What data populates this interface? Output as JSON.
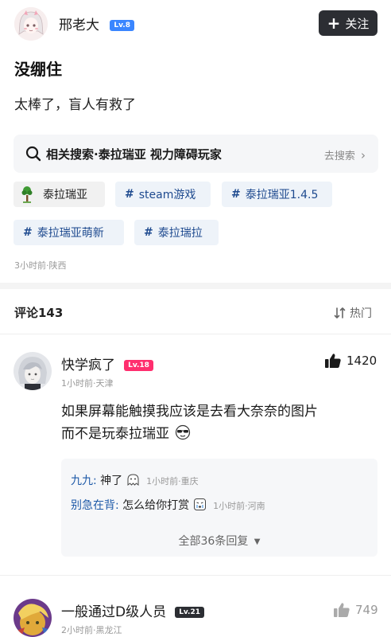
{
  "author": {
    "name": "邢老大",
    "level": "Lv.8",
    "follow_label": "关注"
  },
  "post": {
    "title": "没绷住",
    "body": "太棒了，盲人有救了",
    "related_search": {
      "label": "相关搜索·泰拉瑞亚 视力障碍玩家",
      "action": "去搜索"
    },
    "tags": [
      {
        "label": "泰拉瑞亚"
      },
      {
        "label": "steam游戏"
      },
      {
        "label": "泰拉瑞亚1.4.5"
      },
      {
        "label": "泰拉瑞亚萌新"
      },
      {
        "label": "泰拉瑞拉"
      }
    ],
    "meta": "3小时前·陕西"
  },
  "comments_header": {
    "title": "评论143",
    "sort_label": "热门"
  },
  "comments": [
    {
      "name": "快学疯了",
      "level": "Lv.18",
      "meta": "1小时前·天津",
      "likes": "1420",
      "text_line1": "如果屏幕能触摸我应该是去看大奈奈的图片",
      "text_line2": "而不是玩泰拉瑞亚",
      "replies": [
        {
          "name": "九九",
          "text": "神了",
          "meta": "1小时前·重庆"
        },
        {
          "name": "别急在背",
          "text": "怎么给你打赏",
          "meta": "1小时前·河南"
        }
      ],
      "more_replies": "全部36条回复"
    },
    {
      "name": "一般通过D级人员",
      "level": "Lv.21",
      "meta": "2小时前·黑龙江",
      "likes": "749"
    }
  ],
  "colors": {
    "level_badge": "#3a86ff",
    "level_badge_hot": "#ff2e6e",
    "follow_bg": "#2c2e33",
    "tag_text": "#1e4a8f",
    "reply_name": "#1e5aa8"
  }
}
